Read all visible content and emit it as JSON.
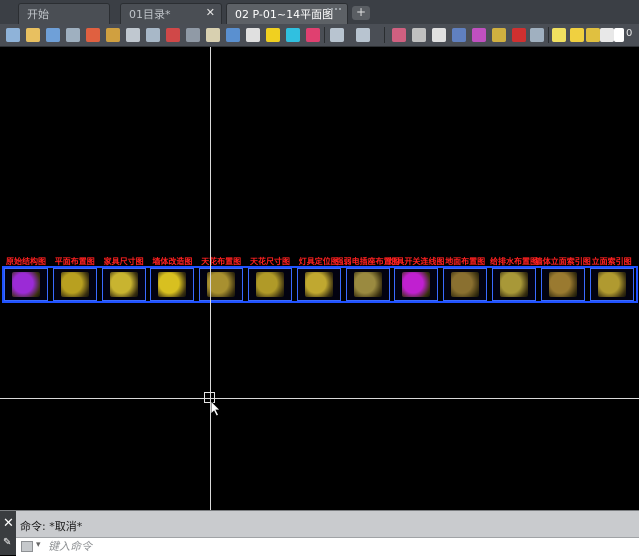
{
  "tabs": [
    {
      "label": "开始",
      "active": false
    },
    {
      "label": "01目录*",
      "active": false
    },
    {
      "label": "02 P-01~14平面图",
      "active": true
    }
  ],
  "new_tab_label": "+",
  "toolbar": {
    "layer_value": "0"
  },
  "drawing": {
    "sheets": [
      {
        "label": "原始结构图",
        "color": "#9b2bd6"
      },
      {
        "label": "平面布置图",
        "color": "#b8a020"
      },
      {
        "label": "家具尺寸图",
        "color": "#c8b430"
      },
      {
        "label": "墙体改造图",
        "color": "#d8c020"
      },
      {
        "label": "天花布置图",
        "color": "#a89030"
      },
      {
        "label": "天花尺寸图",
        "color": "#b09a28"
      },
      {
        "label": "灯具定位图",
        "color": "#c0a830"
      },
      {
        "label": "强弱电插座布置图",
        "color": "#9a8a40"
      },
      {
        "label": "灯具开关连线图",
        "color": "#c020d0"
      },
      {
        "label": "地面布置图",
        "color": "#8a7030"
      },
      {
        "label": "给排水布置图",
        "color": "#a89838"
      },
      {
        "label": "墙体立面索引图",
        "color": "#9a7a30"
      },
      {
        "label": "立面索引图",
        "color": "#b09a30"
      }
    ]
  },
  "command": {
    "history": "命令: *取消*",
    "input_placeholder": "键入命令",
    "close_label": "✕",
    "wrench_label": "🔧"
  }
}
